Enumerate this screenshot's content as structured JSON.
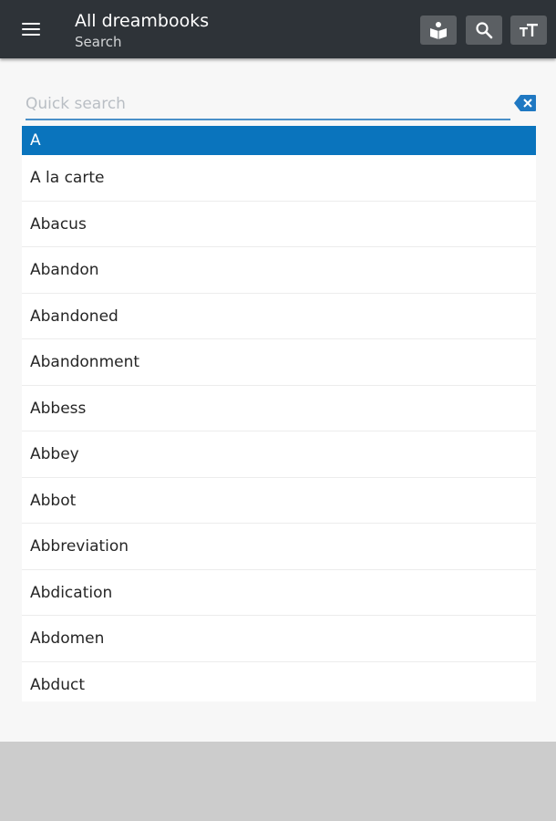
{
  "header": {
    "title": "All dreambooks",
    "subtitle": "Search"
  },
  "actions": {
    "book": "book-icon",
    "search": "search-icon",
    "text_size": "text-size-icon"
  },
  "search": {
    "value": "",
    "placeholder": "Quick search"
  },
  "list": {
    "section": "A",
    "items": [
      "A la carte",
      "Abacus",
      "Abandon",
      "Abandoned",
      "Abandonment",
      "Abbess",
      "Abbey",
      "Abbot",
      "Abbreviation",
      "Abdication",
      "Abdomen",
      "Abduct"
    ]
  },
  "colors": {
    "toolbar": "#2e3338",
    "accent": "#0a74bd",
    "action_button": "#5b5f63"
  }
}
